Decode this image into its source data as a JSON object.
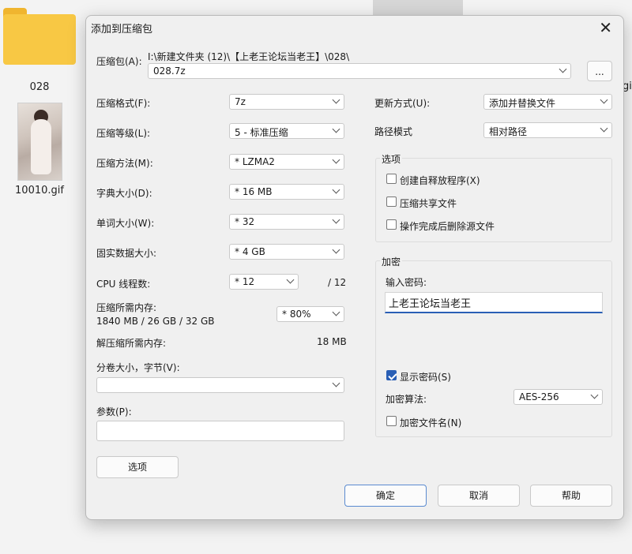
{
  "desktop": {
    "folder_label": "028",
    "file_label": "10010.gif",
    "partial_label": "gif"
  },
  "dialog": {
    "title": "添加到压缩包",
    "archive_label": "压缩包(A):",
    "archive_path": "I:\\新建文件夹 (12)\\【上老王论坛当老王】\\028\\",
    "archive_name": "028.7z",
    "browse_label": "...",
    "format_label": "压缩格式(F):",
    "format_value": "7z",
    "level_label": "压缩等级(L):",
    "level_value": "5 - 标准压缩",
    "method_label": "压缩方法(M):",
    "method_value": "* LZMA2",
    "dict_label": "字典大小(D):",
    "dict_value": "* 16 MB",
    "word_label": "单词大小(W):",
    "word_value": "* 32",
    "solid_label": "固实数据大小:",
    "solid_value": "* 4 GB",
    "cpu_label": "CPU 线程数:",
    "cpu_value": "* 12",
    "cpu_total": "/ 12",
    "mem_label": "压缩所需内存:",
    "mem_detail": "1840 MB / 26 GB / 32 GB",
    "mem_value": "* 80%",
    "decomp_label": "解压缩所需内存:",
    "decomp_value": "18 MB",
    "split_label": "分卷大小，字节(V):",
    "split_value": "",
    "params_label": "参数(P):",
    "params_value": "",
    "options_button": "选项",
    "update_label": "更新方式(U):",
    "update_value": "添加并替换文件",
    "path_label": "路径模式",
    "path_value": "相对路径",
    "options_group_title": "选项",
    "opt_sfx": "创建自释放程序(X)",
    "opt_shared": "压缩共享文件",
    "opt_delete": "操作完成后删除源文件",
    "encrypt_group_title": "加密",
    "password_label": "输入密码:",
    "password_value": "上老王论坛当老王",
    "show_password": "显示密码(S)",
    "algo_label": "加密算法:",
    "algo_value": "AES-256",
    "encrypt_names": "加密文件名(N)",
    "ok_button": "确定",
    "cancel_button": "取消",
    "help_button": "帮助"
  },
  "checkboxes": {
    "sfx": false,
    "shared": false,
    "delete": false,
    "show_password": true,
    "encrypt_names": false
  },
  "colors": {
    "accent": "#2a5fb5",
    "folder": "#f8c844"
  }
}
